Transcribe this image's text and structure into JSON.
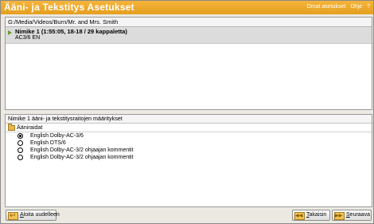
{
  "window": {
    "title": "Ääni- ja Tekstitys Asetukset",
    "links": {
      "settings": "Omat asetukset",
      "help": "Ohje",
      "question": "?"
    }
  },
  "top_panel": {
    "path": "G:/Media/Videos/Burn/Mr. and Mrs. Smith",
    "title_item": {
      "name": "Nimike 1 (1:55:05, 18-18 / 29 kappaletta)",
      "detail": "AC3/6 EN"
    }
  },
  "bottom_panel": {
    "section_label": "Nimike 1 ääni- ja tekstitysraitojen määritykset",
    "group_label": "Ääniraidat",
    "tracks": [
      {
        "label": "English Dolby-AC-3/6",
        "checked": true
      },
      {
        "label": "English DTS/6",
        "checked": false
      },
      {
        "label": "English Dolby-AC-3/2 ohjaajan kommentit",
        "checked": false
      },
      {
        "label": "English Dolby-AC-3/2 ohjaajan kommentit",
        "checked": false
      }
    ]
  },
  "buttons": {
    "restart": "Aloita uudelleen",
    "back": "Takaisin",
    "next": "Seuraava"
  },
  "colors": {
    "title_bar": "#e9a526",
    "accent": "#f1c452"
  }
}
